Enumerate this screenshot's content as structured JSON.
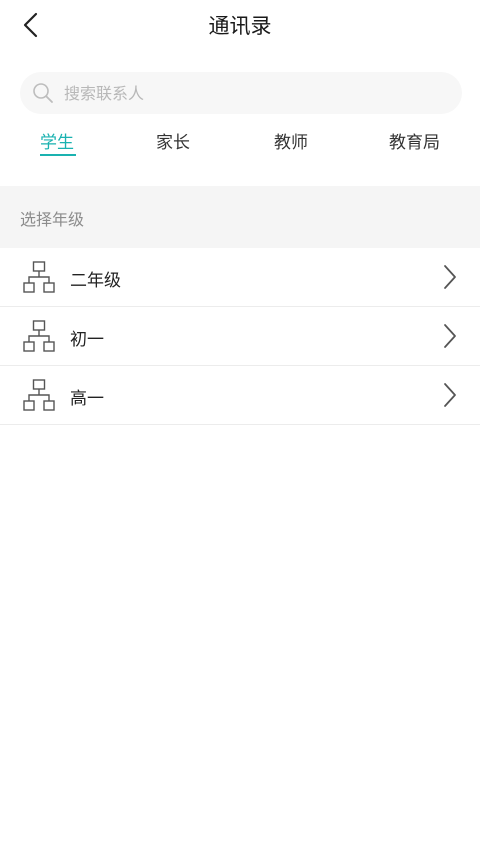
{
  "header": {
    "title": "通讯录"
  },
  "search": {
    "placeholder": "搜索联系人",
    "value": ""
  },
  "tabs": [
    {
      "label": "学生",
      "active": true
    },
    {
      "label": "家长",
      "active": false
    },
    {
      "label": "教师",
      "active": false
    },
    {
      "label": "教育局",
      "active": false
    }
  ],
  "section": {
    "label": "选择年级"
  },
  "grades": [
    {
      "label": "二年级"
    },
    {
      "label": "初一"
    },
    {
      "label": "高一"
    }
  ],
  "colors": {
    "accent": "#1ab2b0",
    "section_bg": "#f5f5f5",
    "muted_text": "#8c8c8c",
    "search_bg": "#f7f7f7"
  },
  "icons": {
    "back": "chevron-left-icon",
    "search": "search-icon",
    "grade": "org-chart-icon",
    "row_arrow": "chevron-right-icon"
  }
}
